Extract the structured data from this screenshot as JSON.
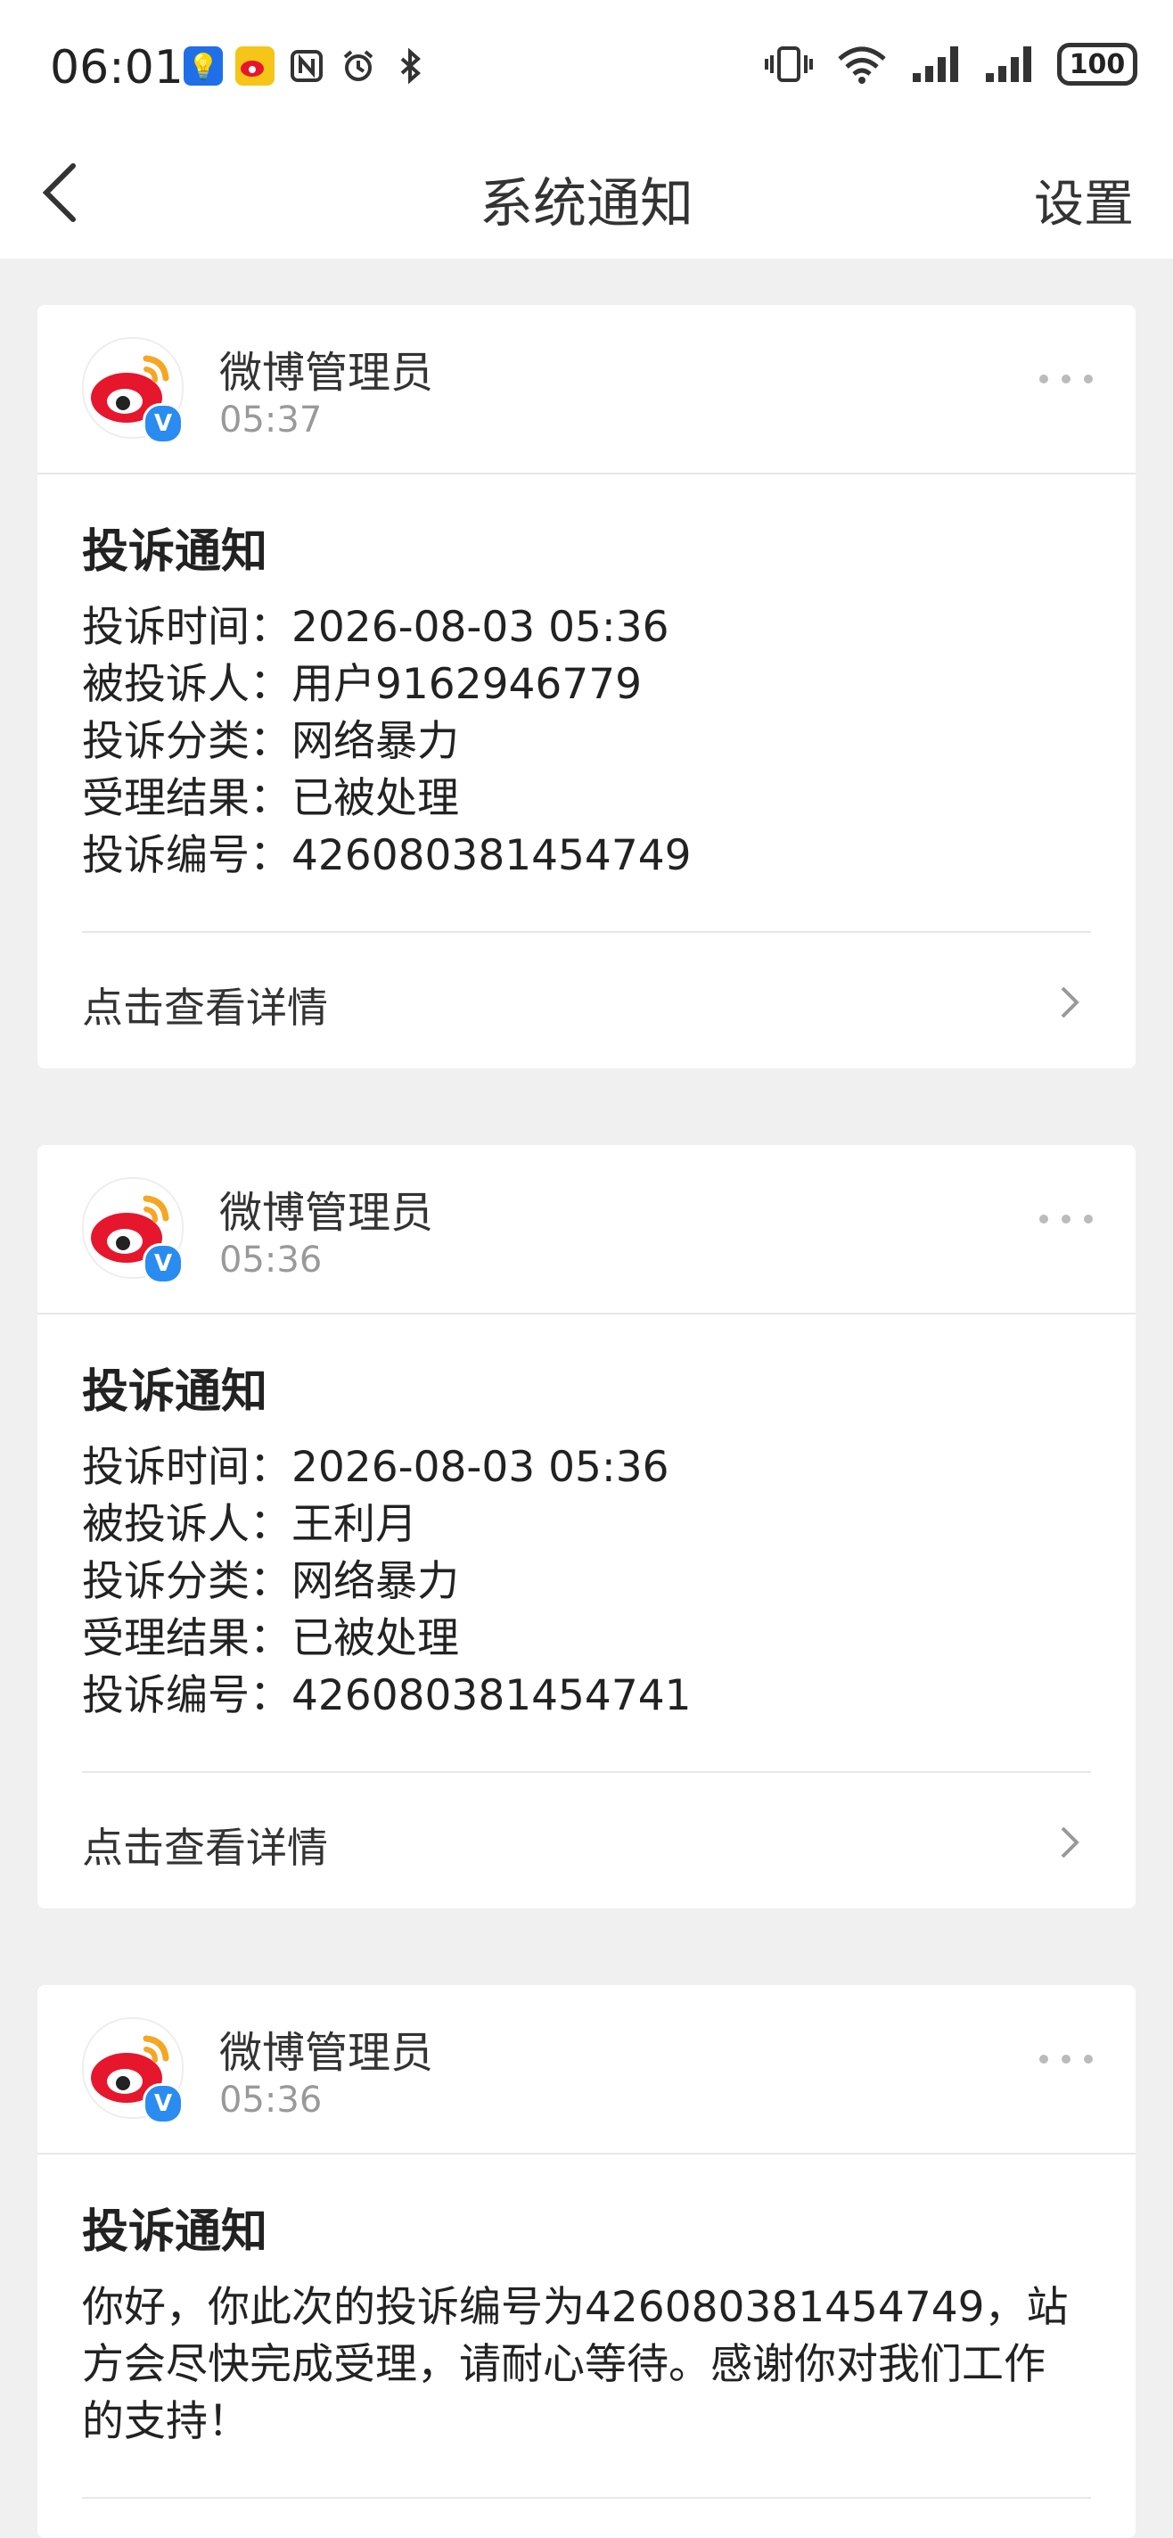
{
  "status_bar": {
    "time": "06:01",
    "battery": "100",
    "icons": [
      "bulb-icon",
      "weibo-icon",
      "nfc-icon",
      "alarm-icon",
      "bluetooth-icon",
      "vibrate-icon",
      "wifi-icon",
      "signal-icon",
      "signal-icon"
    ]
  },
  "nav": {
    "title": "系统通知",
    "right": "设置"
  },
  "cards": [
    {
      "sender": "微博管理员",
      "time": "05:37",
      "title": "投诉通知",
      "rows": [
        "投诉时间：2026-08-03 05:36",
        "被投诉人：用户9162946779",
        "投诉分类：网络暴力",
        "受理结果：已被处理",
        "投诉编号：426080381454749"
      ],
      "detail": "点击查看详情"
    },
    {
      "sender": "微博管理员",
      "time": "05:36",
      "title": "投诉通知",
      "rows": [
        "投诉时间：2026-08-03 05:36",
        "被投诉人：王利月",
        "投诉分类：网络暴力",
        "受理结果：已被处理",
        "投诉编号：426080381454741"
      ],
      "detail": "点击查看详情"
    },
    {
      "sender": "微博管理员",
      "time": "05:36",
      "title": "投诉通知",
      "message_lines": [
        "你好，你此次的投诉编号为426080381454749，站",
        "方会尽快完成受理，请耐心等待。感谢你对我们工作",
        "的支持！"
      ]
    }
  ],
  "colors": {
    "background": "#f0f0f0",
    "card": "#ffffff",
    "verified_badge": "#2a8cf0",
    "weibo_red": "#e6162d",
    "weibo_orange": "#f5a623"
  }
}
